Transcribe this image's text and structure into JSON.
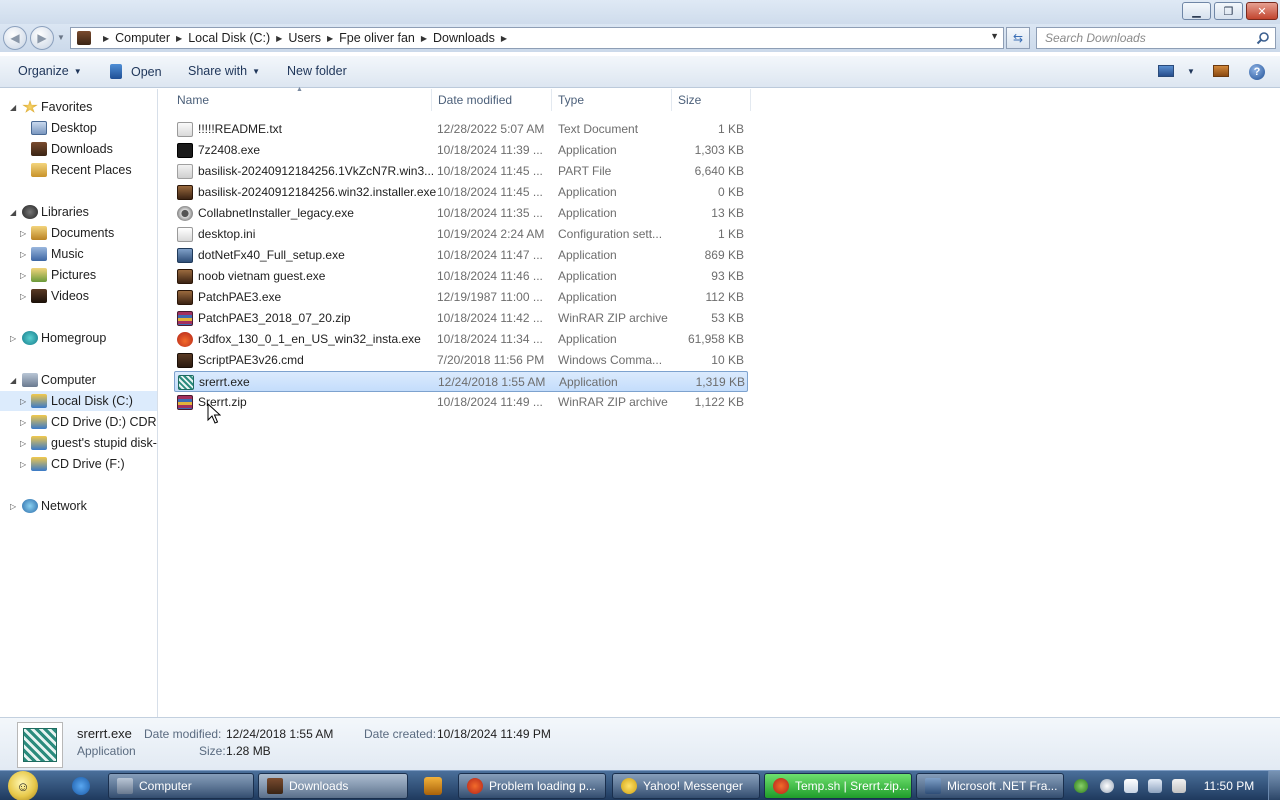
{
  "window": {
    "minimize_glyph": "▁",
    "maximize_glyph": "❐",
    "close_glyph": "✕"
  },
  "address": {
    "breadcrumbs": [
      "Computer",
      "Local Disk (C:)",
      "Users",
      "Fpe oliver fan",
      "Downloads"
    ],
    "search_placeholder": "Search Downloads"
  },
  "toolbar": {
    "organize_label": "Organize",
    "open_label": "Open",
    "share_label": "Share with",
    "newfolder_label": "New folder",
    "help_glyph": "?"
  },
  "nav": {
    "favorites": "Favorites",
    "desktop": "Desktop",
    "downloads": "Downloads",
    "recent_places": "Recent Places",
    "libraries": "Libraries",
    "documents": "Documents",
    "music": "Music",
    "pictures": "Pictures",
    "videos": "Videos",
    "homegroup": "Homegroup",
    "computer": "Computer",
    "local_disk": "Local Disk (C:)",
    "cd_drive_d": "CD Drive (D:) CDROM",
    "guest_disk": "guest's stupid disk-u",
    "cd_drive_f": "CD Drive (F:)",
    "network": "Network"
  },
  "columns": {
    "name": "Name",
    "date": "Date modified",
    "type": "Type",
    "size": "Size"
  },
  "files": [
    {
      "name": "!!!!!README.txt",
      "date": "12/28/2022 5:07 AM",
      "type": "Text Document",
      "size": "1 KB",
      "icon": "txt"
    },
    {
      "name": "7z2408.exe",
      "date": "10/18/2024 11:39 ...",
      "type": "Application",
      "size": "1,303 KB",
      "icon": "7z"
    },
    {
      "name": "basilisk-20240912184256.1VkZcN7R.win3...",
      "date": "10/18/2024 11:45 ...",
      "type": "PART File",
      "size": "6,640 KB",
      "icon": "part"
    },
    {
      "name": "basilisk-20240912184256.win32.installer.exe",
      "date": "10/18/2024 11:45 ...",
      "type": "Application",
      "size": "0 KB",
      "icon": "app"
    },
    {
      "name": "CollabnetInstaller_legacy.exe",
      "date": "10/18/2024 11:35 ...",
      "type": "Application",
      "size": "13 KB",
      "icon": "collab"
    },
    {
      "name": "desktop.ini",
      "date": "10/19/2024 2:24 AM",
      "type": "Configuration sett...",
      "size": "1 KB",
      "icon": "ini"
    },
    {
      "name": "dotNetFx40_Full_setup.exe",
      "date": "10/18/2024 11:47 ...",
      "type": "Application",
      "size": "869 KB",
      "icon": "net"
    },
    {
      "name": "noob vietnam guest.exe",
      "date": "10/18/2024 11:46 ...",
      "type": "Application",
      "size": "93 KB",
      "icon": "app"
    },
    {
      "name": "PatchPAE3.exe",
      "date": "12/19/1987 11:00 ...",
      "type": "Application",
      "size": "112 KB",
      "icon": "app"
    },
    {
      "name": "PatchPAE3_2018_07_20.zip",
      "date": "10/18/2024 11:42 ...",
      "type": "WinRAR ZIP archive",
      "size": "53 KB",
      "icon": "rar"
    },
    {
      "name": "r3dfox_130_0_1_en_US_win32_insta.exe",
      "date": "10/18/2024 11:34 ...",
      "type": "Application",
      "size": "61,958 KB",
      "icon": "fox"
    },
    {
      "name": "ScriptPAE3v26.cmd",
      "date": "7/20/2018 11:56 PM",
      "type": "Windows Comma...",
      "size": "10 KB",
      "icon": "cmd"
    },
    {
      "name": "srerrt.exe",
      "date": "12/24/2018 1:55 AM",
      "type": "Application",
      "size": "1,319 KB",
      "icon": "srerrt",
      "selected": true
    },
    {
      "name": "Srerrt.zip",
      "date": "10/18/2024 11:49 ...",
      "type": "WinRAR ZIP archive",
      "size": "1,122 KB",
      "icon": "rar"
    }
  ],
  "details": {
    "filename": "srerrt.exe",
    "filetype": "Application",
    "modified_label": "Date modified:",
    "modified_value": "12/24/2018 1:55 AM",
    "size_label": "Size:",
    "size_value": "1.28 MB",
    "created_label": "Date created:",
    "created_value": "10/18/2024 11:49 PM"
  },
  "taskbar": {
    "tasks": [
      "Computer",
      "Downloads",
      "Problem loading p...",
      "Yahoo! Messenger",
      "Temp.sh | Srerrt.zip...",
      "Microsoft .NET Fra..."
    ],
    "clock": "11:50 PM"
  }
}
